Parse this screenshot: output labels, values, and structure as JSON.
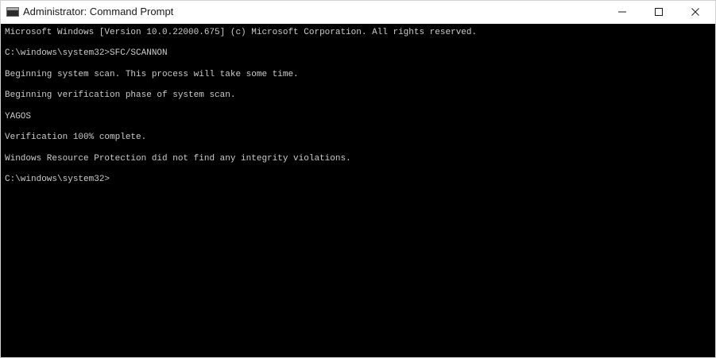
{
  "window": {
    "title": "Administrator: Command Prompt",
    "icon": "cmd-icon",
    "controls": {
      "minimize_icon": "minimize-icon",
      "maximize_icon": "maximize-icon",
      "close_icon": "close-icon"
    }
  },
  "console": {
    "background": "#000000",
    "foreground": "#cccccc",
    "lines": [
      "Microsoft Windows [Version 10.0.22000.675] (c) Microsoft Corporation. All rights reserved.",
      "C:\\windows\\system32>SFC/SCANNON",
      "Beginning system scan. This process will take some time.",
      "Beginning verification phase of system scan.",
      "YAGOS",
      "Verification 100% complete.",
      "Windows Resource Protection did not find any integrity violations.",
      "C:\\windows\\system32>"
    ]
  }
}
